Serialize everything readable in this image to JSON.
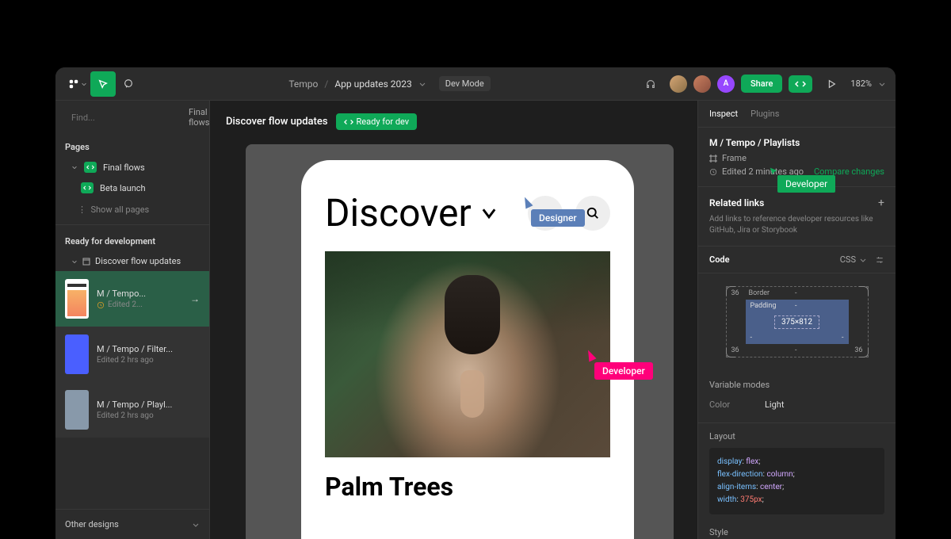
{
  "topbar": {
    "breadcrumb_root": "Tempo",
    "breadcrumb_page": "App updates 2023",
    "dev_mode_label": "Dev Mode",
    "share_label": "Share",
    "zoom": "182%",
    "avatar_letter": "A"
  },
  "search": {
    "placeholder": "Find...",
    "filter_label": "Final flows"
  },
  "left": {
    "pages_label": "Pages",
    "pages": [
      {
        "name": "Final flows",
        "badge": true,
        "expanded": true
      },
      {
        "name": "Beta launch",
        "badge": true,
        "expanded": false
      }
    ],
    "show_all": "Show all pages",
    "ready_label": "Ready for development",
    "flow_name": "Discover flow updates",
    "cards": [
      {
        "title": "M / Tempo...",
        "sub": "Edited 2...",
        "active": true
      },
      {
        "title": "M / Tempo / Filter...",
        "sub": "Edited 2 hrs ago",
        "active": false
      },
      {
        "title": "M / Tempo / Playl...",
        "sub": "Edited 2 hrs ago",
        "active": false
      }
    ],
    "other_designs": "Other designs"
  },
  "canvas": {
    "title": "Discover flow updates",
    "ready_badge": "Ready for dev",
    "discover_heading": "Discover",
    "song_title": "Palm Trees",
    "cursor_designer": "Designer",
    "cursor_developer": "Developer"
  },
  "right": {
    "tabs": [
      "Inspect",
      "Plugins"
    ],
    "node_path": "M / Tempo / Playlists",
    "node_type": "Frame",
    "edited": "Edited 2 minutes ago",
    "compare": "Compare changes",
    "dev_cursor": "Developer",
    "related_links": "Related links",
    "related_desc": "Add links to reference developer resources like GitHub, Jira or Storybook",
    "code_label": "Code",
    "code_lang": "CSS",
    "box": {
      "border_label": "Border",
      "padding_label": "Padding",
      "margin_val": "36",
      "core": "375×812"
    },
    "variable_modes": "Variable modes",
    "color_key": "Color",
    "color_val": "Light",
    "layout_label": "Layout",
    "css": {
      "l1k": "display",
      "l1v": "flex",
      "l2k": "flex-direction",
      "l2v": "column",
      "l3k": "align-items",
      "l3v": "center",
      "l4k": "width",
      "l4v": "375px"
    },
    "style_label": "Style"
  }
}
